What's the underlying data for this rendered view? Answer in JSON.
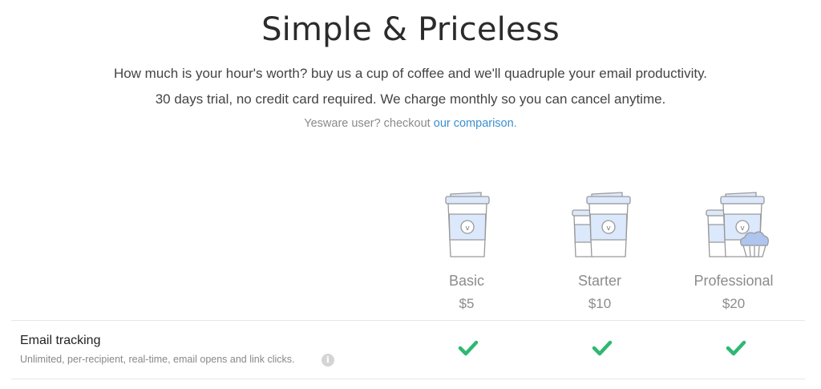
{
  "header": {
    "title": "Simple & Priceless",
    "line1": "How much is your hour's worth? buy us a cup of coffee and we'll quadruple your email productivity.",
    "line2": "30 days trial, no credit card required. We charge monthly so you can cancel anytime.",
    "yesware_prefix": "Yesware user? checkout ",
    "yesware_link": "our comparison",
    "yesware_suffix": "."
  },
  "plans": [
    {
      "name": "Basic",
      "price": "$5",
      "icon": "single-coffee-cup-icon"
    },
    {
      "name": "Starter",
      "price": "$10",
      "icon": "two-coffee-cups-icon"
    },
    {
      "name": "Professional",
      "price": "$20",
      "icon": "two-coffee-cups-and-muffin-icon"
    }
  ],
  "features": [
    {
      "title": "Email tracking",
      "description": "Unlimited, per-recipient, real-time, email opens and link clicks.",
      "info_glyph": "i",
      "included": [
        true,
        true,
        true
      ]
    }
  ],
  "colors": {
    "cup_outline": "#9a9a9a",
    "cup_band": "#dce8fb",
    "check": "#2eb872",
    "link": "#3a8fd0"
  }
}
